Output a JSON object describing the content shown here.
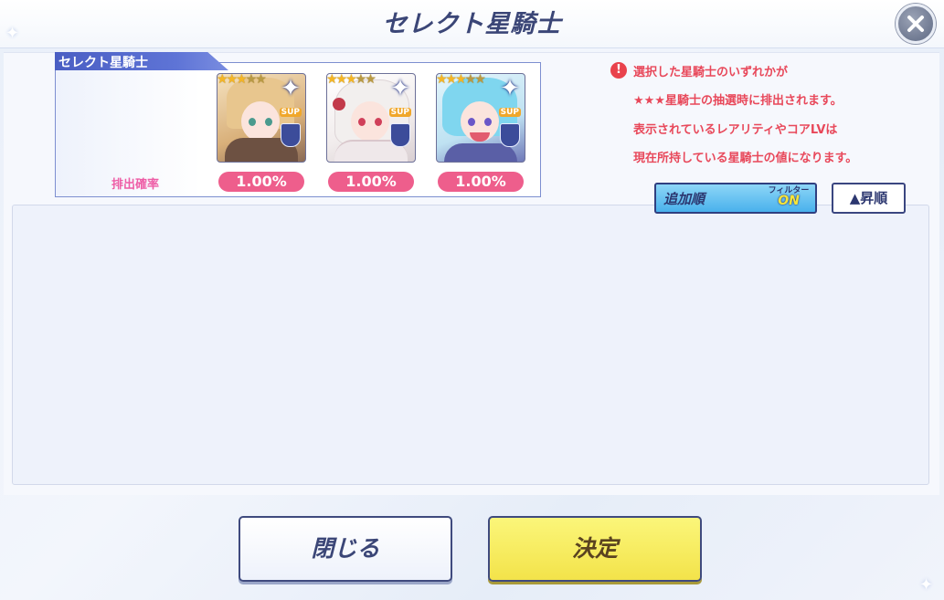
{
  "header": {
    "title": "セレクト星騎士"
  },
  "select_panel": {
    "tab_label": "セレクト星騎士",
    "rate_label": "排出確率",
    "characters": [
      {
        "rarity": 3,
        "type_badge": "SUP",
        "rate": "1.00%",
        "hair": "#e8c68e",
        "eyes": "#4a9a8e"
      },
      {
        "rarity": 3,
        "type_badge": "SUP",
        "rate": "1.00%",
        "hair": "#f2efee",
        "eyes": "#d0405a"
      },
      {
        "rarity": 3,
        "type_badge": "SUP",
        "rate": "1.00%",
        "hair": "#7fd6ef",
        "eyes": "#6a57c8"
      }
    ]
  },
  "notice": {
    "lines": [
      "選択した星騎士のいずれかが",
      "★★★星騎士の抽選時に排出されます。",
      "表示されているレアリティやコアLVは",
      "現在所持している星騎士の値になります。"
    ]
  },
  "sort": {
    "add_order_label": "追加順",
    "filter_label": "フィルター",
    "filter_state": "ON",
    "order_label": "▲昇順"
  },
  "footer": {
    "close_label": "閉じる",
    "confirm_label": "決定"
  },
  "colors": {
    "title_color": "#3b4677",
    "rate_pill": "#ee5e8c",
    "notice_text": "#e8485a",
    "confirm_button": "#f3e34a"
  }
}
